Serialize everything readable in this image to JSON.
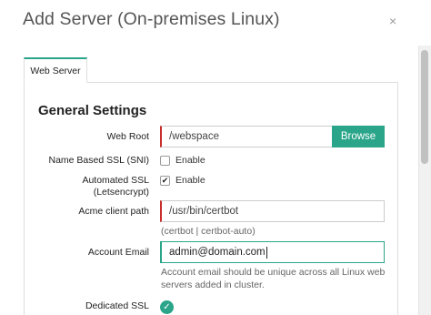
{
  "dialog": {
    "title": "Add Server (On-premises Linux)",
    "close_glyph": "×"
  },
  "tabs": [
    {
      "label": "Web Server",
      "active": true
    }
  ],
  "section": {
    "title": "General Settings"
  },
  "form": {
    "web_root": {
      "label": "Web Root",
      "value": "/webspace",
      "browse_label": "Browse"
    },
    "sni": {
      "label": "Name Based SSL (SNI)",
      "option_label": "Enable",
      "checked": false
    },
    "automated_ssl": {
      "label_line1": "Automated SSL",
      "label_line2": "(Letsencrypt)",
      "option_label": "Enable",
      "checked": true,
      "check_glyph": "✔"
    },
    "acme_path": {
      "label": "Acme client path",
      "value": "/usr/bin/certbot",
      "help": "(certbot | certbot-auto)"
    },
    "account_email": {
      "label": "Account Email",
      "value": "admin@domain.com",
      "help_line1": "Account email should be unique across all Linux web",
      "help_line2": "servers added in cluster."
    },
    "dedicated_ssl": {
      "label": "Dedicated SSL",
      "enabled": true,
      "check_glyph": "✓"
    }
  },
  "colors": {
    "accent": "#2aa58a",
    "required_marker": "#c9302c"
  }
}
